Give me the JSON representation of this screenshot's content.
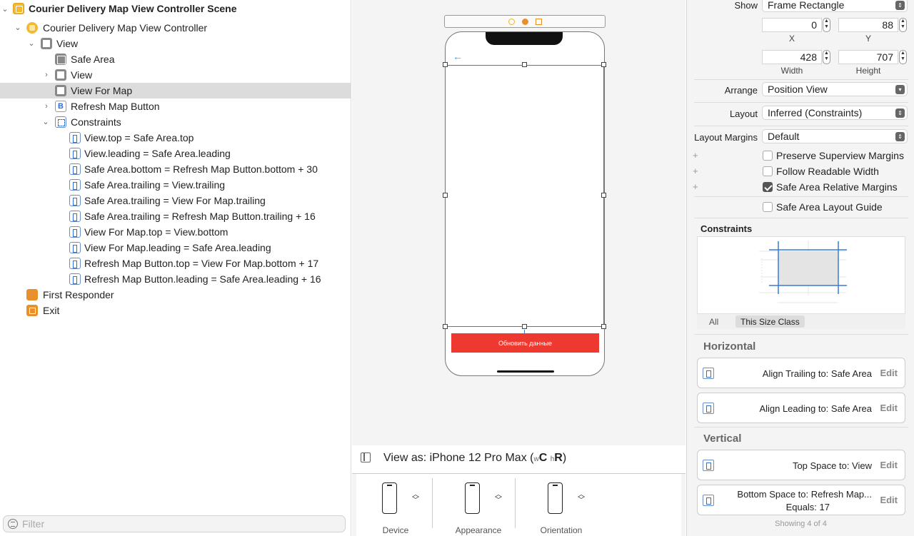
{
  "outline": {
    "rows": [
      {
        "label": "Courier Delivery Map View Controller Scene"
      },
      {
        "label": "Courier Delivery Map View Controller"
      },
      {
        "label": "View"
      },
      {
        "label": "Safe Area"
      },
      {
        "label": "View"
      },
      {
        "label": "View For Map"
      },
      {
        "label": "Refresh Map Button"
      },
      {
        "label": "Constraints"
      },
      {
        "label": "View.top = Safe Area.top"
      },
      {
        "label": "View.leading = Safe Area.leading"
      },
      {
        "label": "Safe Area.bottom = Refresh Map Button.bottom + 30"
      },
      {
        "label": "Safe Area.trailing = View.trailing"
      },
      {
        "label": "Safe Area.trailing = View For Map.trailing"
      },
      {
        "label": "Safe Area.trailing = Refresh Map Button.trailing + 16"
      },
      {
        "label": "View For Map.top = View.bottom"
      },
      {
        "label": "View For Map.leading = Safe Area.leading"
      },
      {
        "label": "Refresh Map Button.top = View For Map.bottom + 17"
      },
      {
        "label": "Refresh Map Button.leading = Safe Area.leading + 16"
      },
      {
        "label": "First Responder"
      },
      {
        "label": "Exit"
      }
    ],
    "button_icon_letter": "B",
    "filter_placeholder": "Filter"
  },
  "canvas": {
    "back_arrow": "←",
    "refresh_button_label": "Обновить данные",
    "view_as": {
      "prefix": "View as: iPhone 12 Pro Max (",
      "w": "w",
      "wc": "C",
      "h": "h",
      "hr": "R",
      "suffix": ")"
    },
    "devices": [
      {
        "label": "Device",
        "icon": "iphone-icon"
      },
      {
        "label": "Appearance",
        "icon": "iphone-icon"
      },
      {
        "label": "Orientation",
        "icon": "iphone-icon"
      }
    ]
  },
  "inspector": {
    "show_label": "Show",
    "show_value": "Frame Rectangle",
    "x_value": "0",
    "y_value": "88",
    "x_label": "X",
    "y_label": "Y",
    "width_value": "428",
    "height_value": "707",
    "width_label": "Width",
    "height_label": "Height",
    "arrange_label": "Arrange",
    "arrange_value": "Position View",
    "layout_label": "Layout",
    "layout_value": "Inferred (Constraints)",
    "margins_label": "Layout Margins",
    "margins_value": "Default",
    "checkboxes": [
      {
        "label": "Preserve Superview Margins",
        "checked": false
      },
      {
        "label": "Follow Readable Width",
        "checked": false
      },
      {
        "label": "Safe Area Relative Margins",
        "checked": true
      },
      {
        "label": "Safe Area Layout Guide",
        "checked": false
      }
    ],
    "plus": "+",
    "constraints_title": "Constraints",
    "tab_all": "All",
    "tab_size": "This Size Class",
    "horizontal_title": "Horizontal",
    "vertical_title": "Vertical",
    "cards": [
      {
        "text": "Align Trailing to:  Safe Area",
        "edit": "Edit"
      },
      {
        "text": "Align Leading to:  Safe Area",
        "edit": "Edit"
      },
      {
        "text": "Top Space to:  View",
        "edit": "Edit"
      },
      {
        "text": "Bottom Space to:  Refresh Map...",
        "text2": "Equals:  17",
        "edit": "Edit"
      }
    ],
    "showing": "Showing 4 of 4"
  },
  "colors": {
    "accent": "#3a7bd5",
    "button_red": "#ee3930",
    "selection": "#dcdcdc"
  }
}
